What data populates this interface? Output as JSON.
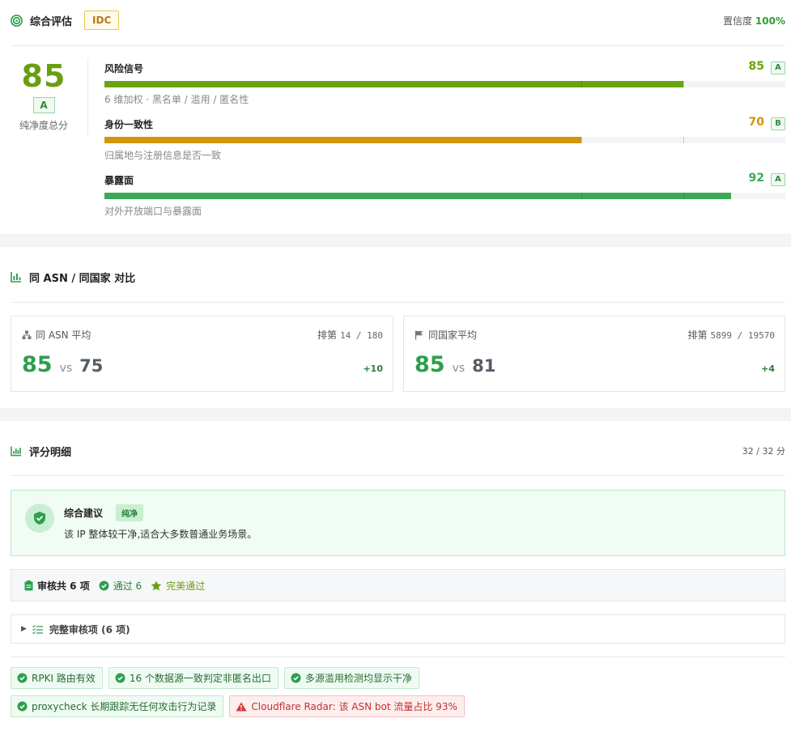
{
  "overview": {
    "title": "综合评估",
    "type_badge": "IDC",
    "confidence_label": "置信度",
    "confidence_value": "100%",
    "score": "85",
    "grade": "A",
    "score_label": "纯净度总分",
    "metrics": [
      {
        "name": "风险信号",
        "value": "85",
        "grade": "A",
        "percent": 85,
        "color": "#69a311",
        "grade_color": "#2f8c3c",
        "desc": "6 维加权 · 黑名单 / 滥用 / 匿名性"
      },
      {
        "name": "身份一致性",
        "value": "70",
        "grade": "B",
        "percent": 70,
        "color": "#d4950b",
        "grade_color": "#2f8c3c",
        "desc": "归属地与注册信息是否一致"
      },
      {
        "name": "暴露面",
        "value": "92",
        "grade": "A",
        "percent": 92,
        "color": "#3ca95a",
        "grade_color": "#2f8c3c",
        "desc": "对外开放端口与暴露面"
      }
    ]
  },
  "comparison": {
    "title": "同 ASN / 同国家 对比",
    "boxes": [
      {
        "label": "同 ASN 平均",
        "icon": "sitemap-icon",
        "rank_label": "排第",
        "rank": "14 / 180",
        "me": "85",
        "vs": "vs",
        "other": "75",
        "delta": "+10"
      },
      {
        "label": "同国家平均",
        "icon": "flag-icon",
        "rank_label": "排第",
        "rank": "5899 / 19570",
        "me": "85",
        "vs": "vs",
        "other": "81",
        "delta": "+4"
      }
    ]
  },
  "details": {
    "title": "评分明细",
    "points": "32 / 32 分",
    "advice": {
      "title": "综合建议",
      "badge": "纯净",
      "text": "该 IP 整体较干净,适合大多数普通业务场景。"
    },
    "audit": {
      "total": "审核共 6 项",
      "passed": "通过 6",
      "perfect": "完美通过"
    },
    "full_audit_label": "完整审核项 (6 项)",
    "tags": [
      {
        "text": "RPKI 路由有效",
        "status": "ok"
      },
      {
        "text": "16 个数据源一致判定非匿名出口",
        "status": "ok"
      },
      {
        "text": "多源滥用检测均显示干净",
        "status": "ok"
      },
      {
        "text": "proxycheck 长期跟踪无任何攻击行为记录",
        "status": "ok"
      },
      {
        "text": "Cloudflare Radar: 该 ASN bot 流量占比 93%",
        "status": "warn"
      }
    ]
  }
}
